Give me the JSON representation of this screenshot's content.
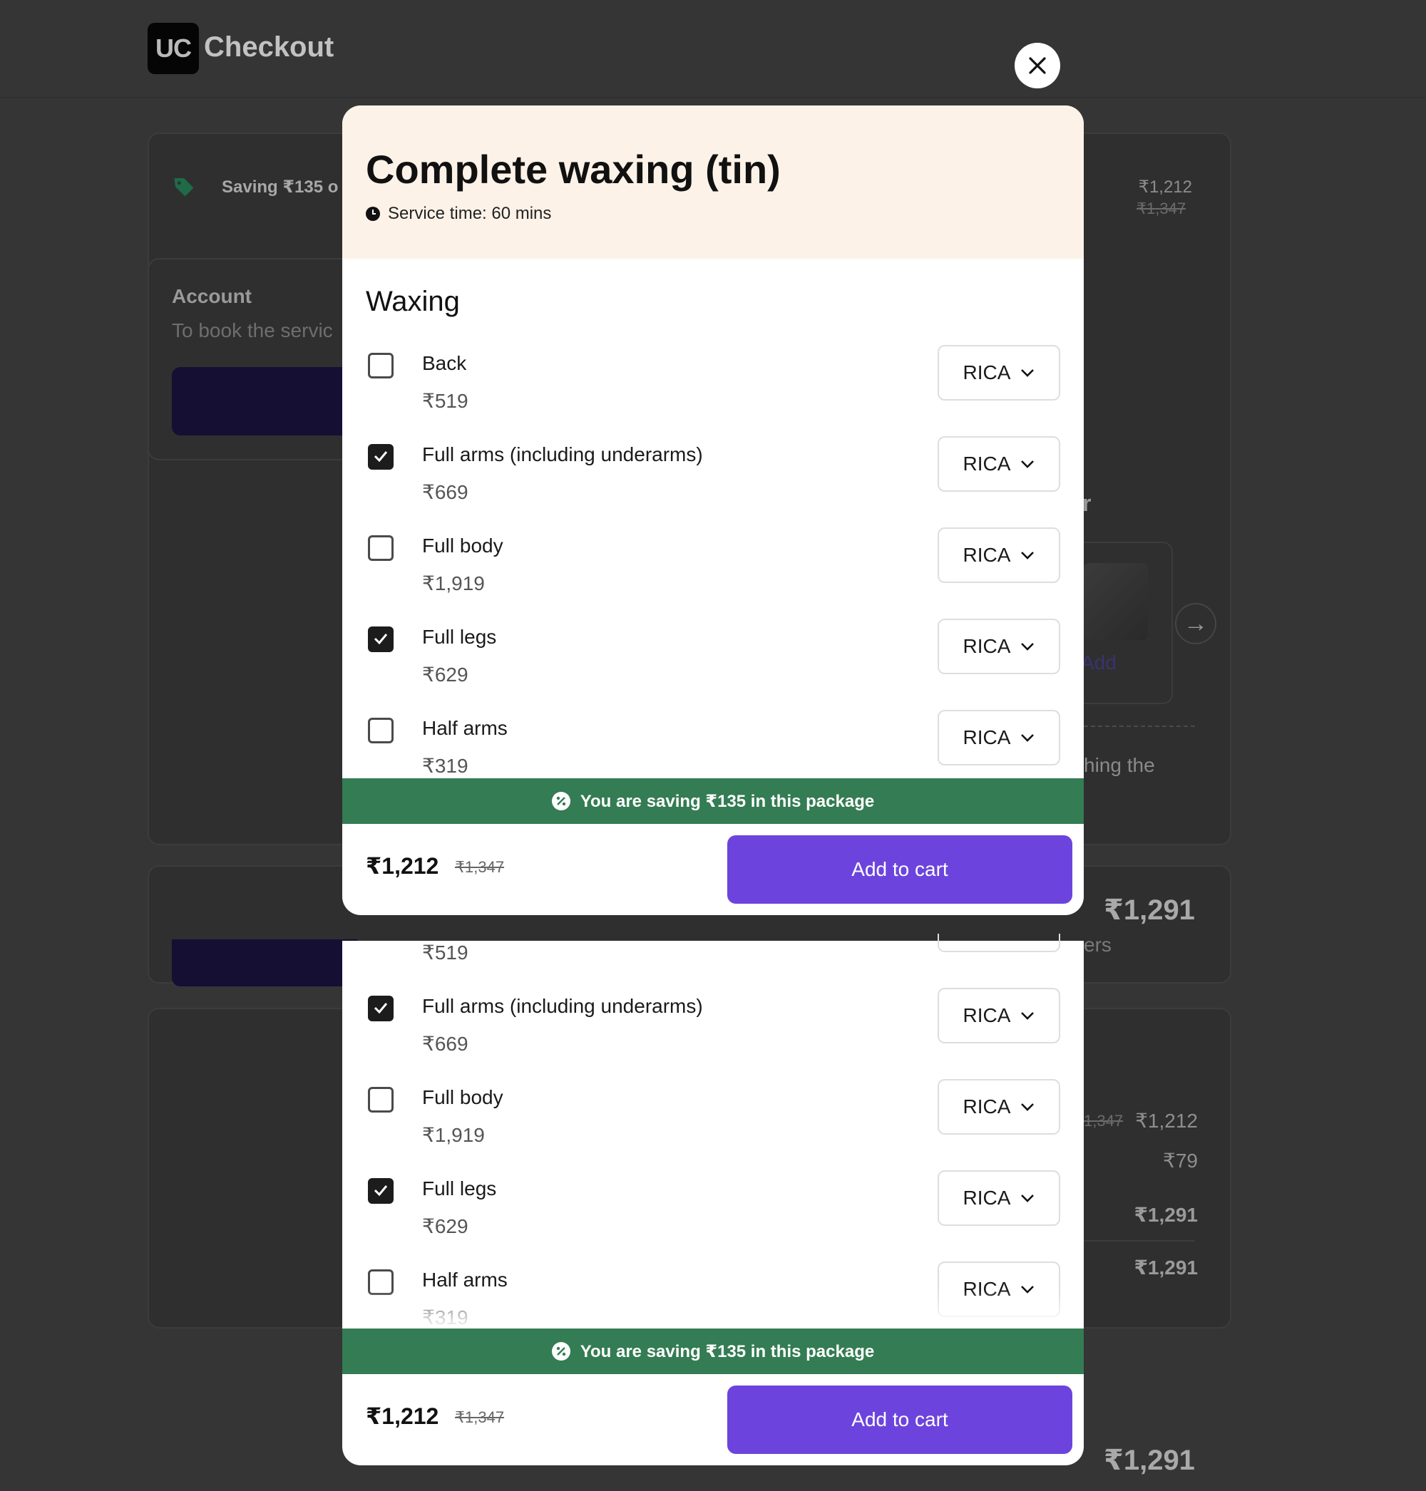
{
  "brand": {
    "logo": "UC",
    "title": "Checkout"
  },
  "background": {
    "saving_text": "Saving ₹135 o",
    "price_current": "₹1,212",
    "price_original": "₹1,347",
    "account_title": "Account",
    "account_subtitle": "To book the servic",
    "section_r": "r",
    "add_label": "Add",
    "matching_text": "hing the",
    "amount_big": "₹1,291",
    "others_text": "ers",
    "summary": [
      {
        "strike": "1,347",
        "value": "₹1,212"
      },
      {
        "strike": "",
        "value": "₹79"
      },
      {
        "strike": "",
        "value": "₹1,291"
      },
      {
        "strike": "",
        "value": "₹1,291"
      }
    ],
    "amount_big_bottom": "₹1,291"
  },
  "modal": {
    "title": "Complete waxing (tin)",
    "service_time": "Service time: 60 mins",
    "section_title": "Waxing",
    "options": [
      {
        "name": "Back",
        "price": "₹519",
        "checked": false,
        "variant": "RICA"
      },
      {
        "name": "Full arms (including underarms)",
        "price": "₹669",
        "checked": true,
        "variant": "RICA"
      },
      {
        "name": "Full body",
        "price": "₹1,919",
        "checked": false,
        "variant": "RICA"
      },
      {
        "name": "Full legs",
        "price": "₹629",
        "checked": true,
        "variant": "RICA"
      },
      {
        "name": "Half arms",
        "price": "₹319",
        "checked": false,
        "variant": "RICA"
      }
    ],
    "saving_banner": "You are saving ₹135 in this package",
    "total_price": "₹1,212",
    "original_price": "₹1,347",
    "cart_button": "Add to cart"
  },
  "icons": {
    "close": "close-icon",
    "clock": "clock-icon",
    "discount": "discount-icon",
    "chevron": "chevron-down-icon",
    "tag": "tag-icon",
    "arrow": "arrow-right-icon"
  },
  "colors": {
    "overlay_bg": "#353535",
    "header_bg": "#fdf2e8",
    "saving_green": "#347c53",
    "brand_purple": "#6c44dd"
  }
}
